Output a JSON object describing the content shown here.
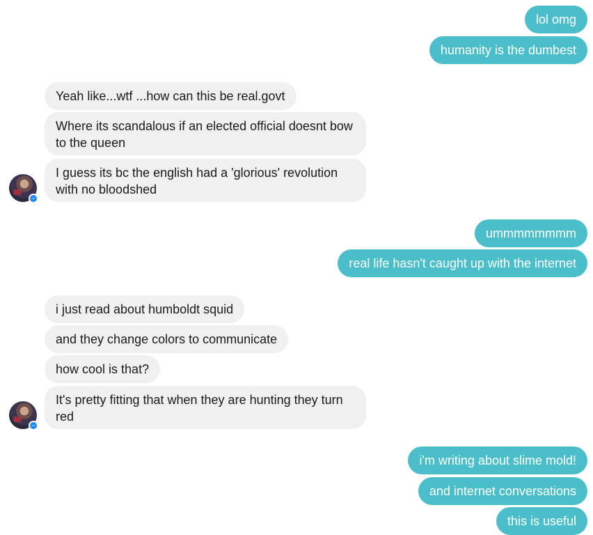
{
  "colors": {
    "outgoing_bubble": "#4bbfc9",
    "incoming_bubble": "#f0f0f0",
    "badge": "#1e88f5"
  },
  "icons": {
    "avatar": "user-avatar-photo",
    "badge": "messenger-badge-icon"
  },
  "messages": {
    "m1": "lol omg",
    "m2": "humanity is the dumbest",
    "m3": "Yeah like...wtf ...how can this be real.govt",
    "m4": "Where its scandalous if an elected official doesnt bow to the queen",
    "m5": "I guess its bc the english had a 'glorious' revolution with no bloodshed",
    "m6": "ummmmmmmm",
    "m7": "real life hasn't caught up with the internet",
    "m8": "i just read about humboldt squid",
    "m9": "and they change colors to communicate",
    "m10": "how cool is that?",
    "m11": "It's pretty fitting that when they are hunting they turn red",
    "m12": "i'm writing about slime mold!",
    "m13": "and internet conversations",
    "m14": "this is useful"
  }
}
